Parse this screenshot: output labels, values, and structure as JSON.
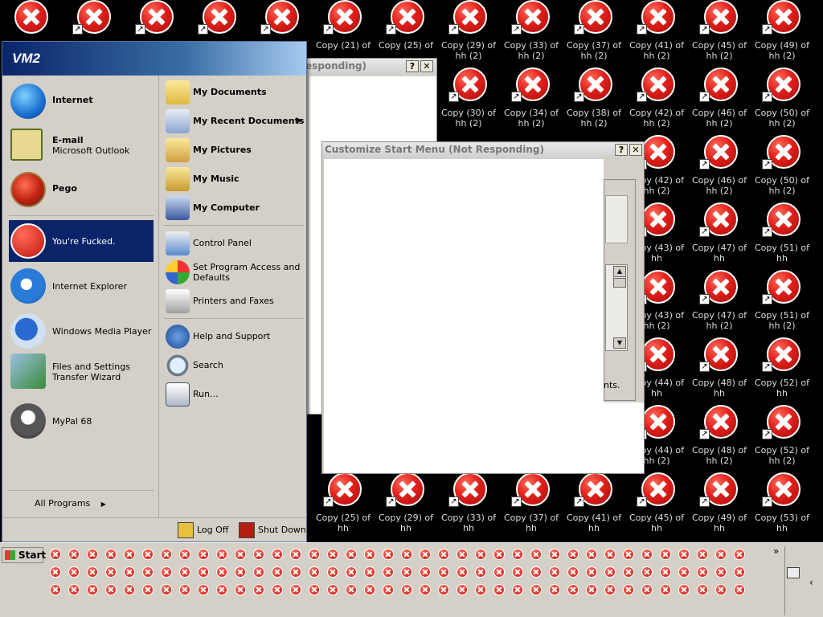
{
  "desktop": {
    "icons": [
      {
        "label": "",
        "shortcut": false
      },
      {
        "label": "",
        "shortcut": true
      },
      {
        "label": "",
        "shortcut": true
      },
      {
        "label": "",
        "shortcut": true
      },
      {
        "label": "",
        "shortcut": true
      },
      {
        "label": "Copy (21) of",
        "shortcut": true
      },
      {
        "label": "Copy (25) of",
        "shortcut": true
      },
      {
        "label": "Copy (29) of hh (2)",
        "shortcut": true
      },
      {
        "label": "Copy (33) of hh (2)",
        "shortcut": true
      },
      {
        "label": "Copy (37) of hh (2)",
        "shortcut": true
      },
      {
        "label": "Copy (41) of hh (2)",
        "shortcut": true
      },
      {
        "label": "Copy (45) of hh (2)",
        "shortcut": true
      },
      {
        "label": "Copy (49) of hh (2)",
        "shortcut": true
      },
      {
        "label": "Copy (30) of hh (2)",
        "shortcut": true
      },
      {
        "label": "Copy (34) of hh (2)",
        "shortcut": true
      },
      {
        "label": "Copy (38) of hh (2)",
        "shortcut": true
      },
      {
        "label": "Copy (42) of hh (2)",
        "shortcut": true
      },
      {
        "label": "Copy (46) of hh (2)",
        "shortcut": true
      },
      {
        "label": "Copy (50) of hh (2)",
        "shortcut": true
      },
      {
        "label": "Copy (42) of hh (2)",
        "shortcut": true
      },
      {
        "label": "Copy (46) of hh (2)",
        "shortcut": true
      },
      {
        "label": "Copy (50) of hh (2)",
        "shortcut": true
      },
      {
        "label": "Copy (43) of hh",
        "shortcut": true
      },
      {
        "label": "Copy (47) of hh",
        "shortcut": true
      },
      {
        "label": "Copy (51) of hh",
        "shortcut": true
      },
      {
        "label": "Copy (43) of hh (2)",
        "shortcut": true
      },
      {
        "label": "Copy (47) of hh (2)",
        "shortcut": true
      },
      {
        "label": "Copy (51) of hh (2)",
        "shortcut": true
      },
      {
        "label": "Copy (44) of hh",
        "shortcut": true
      },
      {
        "label": "Copy (48) of hh",
        "shortcut": true
      },
      {
        "label": "Copy (52) of hh",
        "shortcut": true
      },
      {
        "label": "Copy (44) of hh (2)",
        "shortcut": true
      },
      {
        "label": "Copy (48) of hh (2)",
        "shortcut": true
      },
      {
        "label": "Copy (52) of hh (2)",
        "shortcut": true
      },
      {
        "label": "Copy (25) of hh",
        "shortcut": true
      },
      {
        "label": "Copy (29) of hh",
        "shortcut": true
      },
      {
        "label": "Copy (33) of hh",
        "shortcut": true
      },
      {
        "label": "Copy (37) of hh",
        "shortcut": true
      },
      {
        "label": "Copy (41) of hh",
        "shortcut": true
      },
      {
        "label": "Copy (45) of hh",
        "shortcut": true
      },
      {
        "label": "Copy (49) of hh",
        "shortcut": true
      },
      {
        "label": "Copy (53) of hh",
        "shortcut": true
      }
    ],
    "icon_semantic": "error-x-icon"
  },
  "back_window": {
    "title": "esponding)",
    "help_label": "?",
    "close_label": "✕"
  },
  "customize_window": {
    "title": "Customize Start Menu (Not Responding)",
    "help_label": "?",
    "close_label": "✕",
    "partial_text": "nts.",
    "scroll_up": "▲",
    "scroll_down": "▼"
  },
  "start_menu": {
    "user": "VM2",
    "pinned": [
      {
        "label": "Internet",
        "sub": "",
        "bold": true,
        "icon": "globe-icon"
      },
      {
        "label": "E-mail",
        "sub": "Microsoft Outlook",
        "bold": true,
        "icon": "outlook-icon"
      },
      {
        "label": "Pego",
        "sub": "",
        "bold": true,
        "icon": "pego-icon"
      }
    ],
    "recent": [
      {
        "label": "You're Fucked.",
        "selected": true,
        "icon": "error-x-icon"
      },
      {
        "label": "Internet Explorer",
        "selected": false,
        "icon": "internet-explorer-icon"
      },
      {
        "label": "Windows Media Player",
        "selected": false,
        "icon": "media-player-icon"
      },
      {
        "label": "Files and Settings",
        "label2": "Transfer Wizard",
        "selected": false,
        "icon": "transfer-wizard-icon"
      },
      {
        "label": "MyPal 68",
        "selected": false,
        "icon": "mypal-icon"
      }
    ],
    "all_programs": "All Programs",
    "all_programs_arrow": "▶",
    "right": [
      {
        "label": "My Documents",
        "bold": true,
        "icon": "folder-documents-icon"
      },
      {
        "label": "My Recent Documents",
        "bold": true,
        "arrow": "▶",
        "icon": "recent-documents-icon"
      },
      {
        "label": "My Pictures",
        "bold": true,
        "icon": "folder-pictures-icon"
      },
      {
        "label": "My Music",
        "bold": true,
        "icon": "folder-music-icon"
      },
      {
        "label": "My Computer",
        "bold": true,
        "icon": "computer-icon"
      },
      {
        "label": "Control Panel",
        "bold": false,
        "icon": "control-panel-icon"
      },
      {
        "label": "Set Program Access and",
        "label2": "Defaults",
        "bold": false,
        "icon": "program-access-icon"
      },
      {
        "label": "Printers and Faxes",
        "bold": false,
        "icon": "printer-icon"
      },
      {
        "label": "Help and Support",
        "bold": false,
        "icon": "help-icon"
      },
      {
        "label": "Search",
        "bold": false,
        "icon": "search-icon"
      },
      {
        "label": "Run...",
        "bold": false,
        "icon": "run-icon"
      }
    ],
    "log_off": "Log Off",
    "shut_down": "Shut Down"
  },
  "taskbar": {
    "start_label": "Start",
    "chevron": "»",
    "tray_chevron": "‹",
    "task_icon_semantic": "error-x-icon"
  },
  "colors": {
    "desktop_bg": "#000000",
    "start_header": "#0a246a",
    "selection": "#0a246a",
    "error_red": "#e0201b"
  }
}
